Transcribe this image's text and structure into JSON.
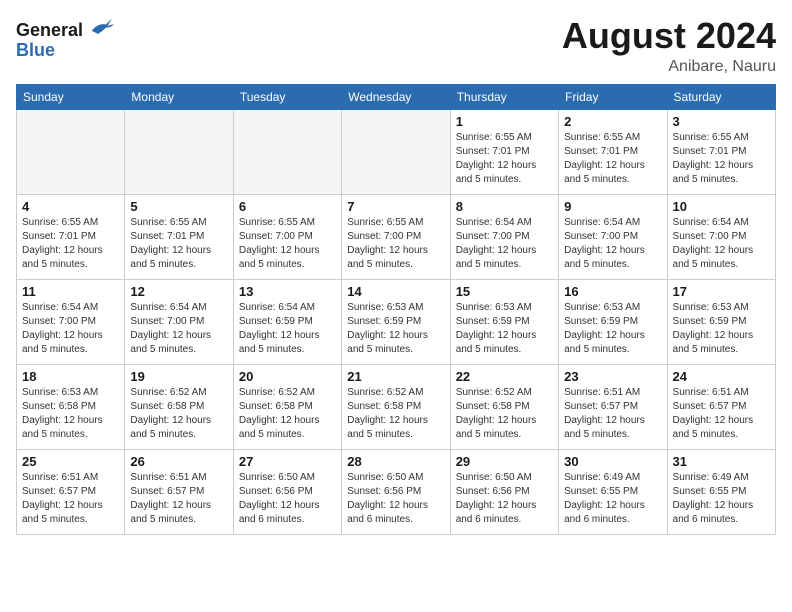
{
  "logo": {
    "general": "General",
    "blue": "Blue"
  },
  "title": {
    "month_year": "August 2024",
    "location": "Anibare, Nauru"
  },
  "weekdays": [
    "Sunday",
    "Monday",
    "Tuesday",
    "Wednesday",
    "Thursday",
    "Friday",
    "Saturday"
  ],
  "weeks": [
    [
      {
        "day": "",
        "empty": true
      },
      {
        "day": "",
        "empty": true
      },
      {
        "day": "",
        "empty": true
      },
      {
        "day": "",
        "empty": true
      },
      {
        "day": "1",
        "sunrise": "6:55 AM",
        "sunset": "7:01 PM",
        "daylight": "12 hours and 5 minutes."
      },
      {
        "day": "2",
        "sunrise": "6:55 AM",
        "sunset": "7:01 PM",
        "daylight": "12 hours and 5 minutes."
      },
      {
        "day": "3",
        "sunrise": "6:55 AM",
        "sunset": "7:01 PM",
        "daylight": "12 hours and 5 minutes."
      }
    ],
    [
      {
        "day": "4",
        "sunrise": "6:55 AM",
        "sunset": "7:01 PM",
        "daylight": "12 hours and 5 minutes."
      },
      {
        "day": "5",
        "sunrise": "6:55 AM",
        "sunset": "7:01 PM",
        "daylight": "12 hours and 5 minutes."
      },
      {
        "day": "6",
        "sunrise": "6:55 AM",
        "sunset": "7:00 PM",
        "daylight": "12 hours and 5 minutes."
      },
      {
        "day": "7",
        "sunrise": "6:55 AM",
        "sunset": "7:00 PM",
        "daylight": "12 hours and 5 minutes."
      },
      {
        "day": "8",
        "sunrise": "6:54 AM",
        "sunset": "7:00 PM",
        "daylight": "12 hours and 5 minutes."
      },
      {
        "day": "9",
        "sunrise": "6:54 AM",
        "sunset": "7:00 PM",
        "daylight": "12 hours and 5 minutes."
      },
      {
        "day": "10",
        "sunrise": "6:54 AM",
        "sunset": "7:00 PM",
        "daylight": "12 hours and 5 minutes."
      }
    ],
    [
      {
        "day": "11",
        "sunrise": "6:54 AM",
        "sunset": "7:00 PM",
        "daylight": "12 hours and 5 minutes."
      },
      {
        "day": "12",
        "sunrise": "6:54 AM",
        "sunset": "7:00 PM",
        "daylight": "12 hours and 5 minutes."
      },
      {
        "day": "13",
        "sunrise": "6:54 AM",
        "sunset": "6:59 PM",
        "daylight": "12 hours and 5 minutes."
      },
      {
        "day": "14",
        "sunrise": "6:53 AM",
        "sunset": "6:59 PM",
        "daylight": "12 hours and 5 minutes."
      },
      {
        "day": "15",
        "sunrise": "6:53 AM",
        "sunset": "6:59 PM",
        "daylight": "12 hours and 5 minutes."
      },
      {
        "day": "16",
        "sunrise": "6:53 AM",
        "sunset": "6:59 PM",
        "daylight": "12 hours and 5 minutes."
      },
      {
        "day": "17",
        "sunrise": "6:53 AM",
        "sunset": "6:59 PM",
        "daylight": "12 hours and 5 minutes."
      }
    ],
    [
      {
        "day": "18",
        "sunrise": "6:53 AM",
        "sunset": "6:58 PM",
        "daylight": "12 hours and 5 minutes."
      },
      {
        "day": "19",
        "sunrise": "6:52 AM",
        "sunset": "6:58 PM",
        "daylight": "12 hours and 5 minutes."
      },
      {
        "day": "20",
        "sunrise": "6:52 AM",
        "sunset": "6:58 PM",
        "daylight": "12 hours and 5 minutes."
      },
      {
        "day": "21",
        "sunrise": "6:52 AM",
        "sunset": "6:58 PM",
        "daylight": "12 hours and 5 minutes."
      },
      {
        "day": "22",
        "sunrise": "6:52 AM",
        "sunset": "6:58 PM",
        "daylight": "12 hours and 5 minutes."
      },
      {
        "day": "23",
        "sunrise": "6:51 AM",
        "sunset": "6:57 PM",
        "daylight": "12 hours and 5 minutes."
      },
      {
        "day": "24",
        "sunrise": "6:51 AM",
        "sunset": "6:57 PM",
        "daylight": "12 hours and 5 minutes."
      }
    ],
    [
      {
        "day": "25",
        "sunrise": "6:51 AM",
        "sunset": "6:57 PM",
        "daylight": "12 hours and 5 minutes."
      },
      {
        "day": "26",
        "sunrise": "6:51 AM",
        "sunset": "6:57 PM",
        "daylight": "12 hours and 5 minutes."
      },
      {
        "day": "27",
        "sunrise": "6:50 AM",
        "sunset": "6:56 PM",
        "daylight": "12 hours and 6 minutes."
      },
      {
        "day": "28",
        "sunrise": "6:50 AM",
        "sunset": "6:56 PM",
        "daylight": "12 hours and 6 minutes."
      },
      {
        "day": "29",
        "sunrise": "6:50 AM",
        "sunset": "6:56 PM",
        "daylight": "12 hours and 6 minutes."
      },
      {
        "day": "30",
        "sunrise": "6:49 AM",
        "sunset": "6:55 PM",
        "daylight": "12 hours and 6 minutes."
      },
      {
        "day": "31",
        "sunrise": "6:49 AM",
        "sunset": "6:55 PM",
        "daylight": "12 hours and 6 minutes."
      }
    ]
  ]
}
